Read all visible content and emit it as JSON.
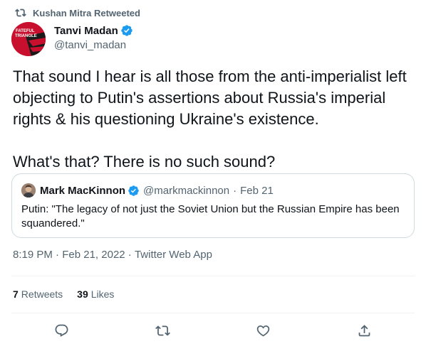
{
  "retweet_banner": {
    "text": "Kushan Mitra Retweeted",
    "icon": "retweet-icon"
  },
  "author": {
    "display_name": "Tanvi Madan",
    "handle": "@tanvi_madan",
    "verified": true,
    "avatar_text_lines": [
      "FATEFUL",
      "TRIANGLE"
    ]
  },
  "tweet": {
    "text": "That sound I hear is all those from the anti-imperialist left objecting to Putin's assertions about Russia's imperial rights & his questioning Ukraine's existence.\n\nWhat's that? There is no such sound?"
  },
  "quote": {
    "display_name": "Mark MacKinnon",
    "handle": "@markmackinnon",
    "separator": "·",
    "date": "Feb 21",
    "verified": true,
    "text": "Putin: \"The legacy of not just the Soviet Union but the Russian Empire has been squandered.\""
  },
  "meta": {
    "time": "8:19 PM",
    "date": "Feb 21, 2022",
    "source": "Twitter Web App",
    "sep": " · "
  },
  "stats": {
    "retweets_count": "7",
    "retweets_label": "Retweets",
    "likes_count": "39",
    "likes_label": "Likes"
  },
  "actions": [
    "reply-icon",
    "retweet-icon",
    "like-icon",
    "share-icon"
  ],
  "colors": {
    "text": "#0f1419",
    "secondary": "#536471",
    "verified": "#1d9bf0",
    "border": "#cfd9de",
    "divider": "#eff3f4",
    "avatar_bg": "#c8102e"
  }
}
